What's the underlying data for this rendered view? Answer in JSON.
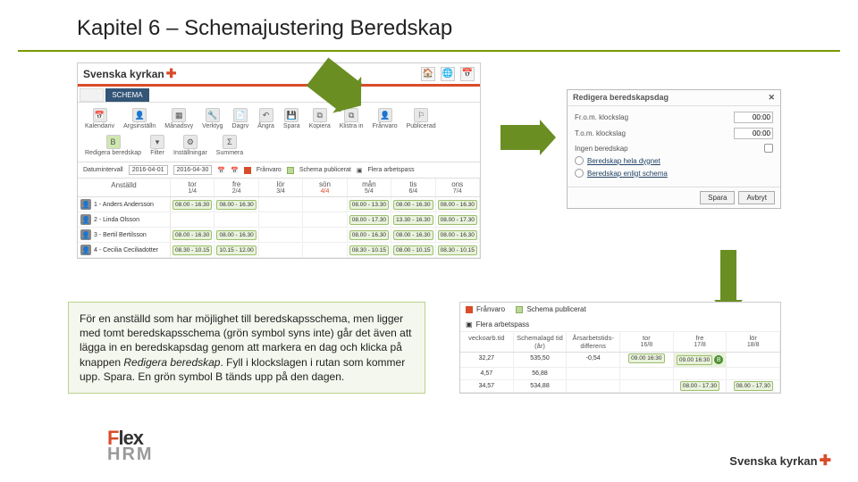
{
  "title": "Kapitel 6 – Schemajustering Beredskap",
  "brand": "Svenska kyrkan",
  "tabs": {
    "t0": "",
    "t1": "SCHEMA"
  },
  "toolbar": {
    "kalendariv": "Kalendariv",
    "argsinstv": "Argsinställn",
    "manadsvy": "Månadsvy",
    "verktyg": "Verktyg",
    "dagrv": "Dagrv",
    "angra": "Ångra",
    "spara": "Spara",
    "kopiera": "Kopiera",
    "klistrain": "Klistra in",
    "franvaro_btn": "Frånvaro",
    "publicerad": "Publicerad",
    "redigera_beredskap": "Redigera beredskap",
    "filter": "Filter",
    "installningar": "Inställningar",
    "summera": "Summera"
  },
  "filter": {
    "label": "Datumintervall",
    "from": "2016-04-01",
    "to": "2016-04-30",
    "franvaro": "Frånvaro",
    "schema_pub": "Schema publicerat",
    "flera": "Flera arbetspass"
  },
  "sched_header": {
    "emp": "Anställd",
    "d1": {
      "dow": "tor",
      "date": "1/4"
    },
    "d2": {
      "dow": "fre",
      "date": "2/4"
    },
    "d3": {
      "dow": "lör",
      "date": "3/4"
    },
    "d4": {
      "dow": "sön",
      "date": "4/4"
    },
    "d5": {
      "dow": "mån",
      "date": "5/4"
    },
    "d6": {
      "dow": "tis",
      "date": "6/4"
    },
    "d7": {
      "dow": "ons",
      "date": "7/4"
    }
  },
  "employees": [
    {
      "name": "1 - Anders Andersson",
      "cells": [
        "08.00 - 16.30",
        "08.00 - 16.30",
        "",
        "",
        "08.00 - 13.30",
        "08.00 - 16.30",
        "08.00 - 16.30"
      ]
    },
    {
      "name": "2 - Linda Olsson",
      "cells": [
        "",
        "",
        "",
        "",
        "08.00 - 17.30",
        "13.30 - 16.30",
        "08.00 - 17.30"
      ]
    },
    {
      "name": "3 - Bertil Bertilsson",
      "cells": [
        "08.00 - 16.30",
        "08.00 - 16.30",
        "",
        "",
        "08.00 - 16.30",
        "08.00 - 16.30",
        "08.00 - 16.30"
      ]
    },
    {
      "name": "4 - Cecilia Ceciliadotter",
      "cells": [
        "08.30 - 10.15",
        "10.15 - 12.00",
        "",
        "",
        "08.30 - 10.15",
        "08.00 - 10.15",
        "08.30 - 10.15"
      ]
    }
  ],
  "dialog": {
    "title": "Redigera beredskapsdag",
    "from_lbl": "Fr.o.m. klockslag",
    "to_lbl": "T.o.m. klockslag",
    "from_val": "00:00",
    "to_val": "00:00",
    "none": "Ingen beredskap",
    "whole": "Beredskap hela dygnet",
    "sched": "Beredskap enligt schema",
    "save": "Spara",
    "cancel": "Avbryt"
  },
  "note": "För en anställd som har möjlighet till beredskapsschema, men ligger med tomt beredskapsschema (grön symbol syns inte) går det även att lägga in en beredskapsdag genom att markera en dag och klicka på knappen <em>Redigera beredskap</em>. Fyll i klockslagen i rutan som kommer upp. Spara. En grön symbol B tänds upp på den dagen.",
  "mini": {
    "franvaro": "Frånvaro",
    "schema_pub": "Schema publicerat",
    "flera": "Flera arbetspass",
    "h1": "veckoarb.tid",
    "h2": "Schemalagd tid (år)",
    "h3": "Årsarbetstids-differens",
    "h4": {
      "dow": "tor",
      "date": "16/8"
    },
    "h5": {
      "dow": "fre",
      "date": "17/8"
    },
    "h6": {
      "dow": "lör",
      "date": "18/8"
    },
    "r1": {
      "c1": "32,27",
      "c2": "535,50",
      "c3": "-0,54",
      "c4": "09.00 16:30",
      "c5": "09.00 16:30",
      "c6": ""
    },
    "r2": {
      "c1": "4,57",
      "c2": "56,88",
      "c3": "",
      "c4": "",
      "c5": "",
      "c6": ""
    },
    "r3": {
      "c1": "34,57",
      "c2": "534,88",
      "c3": "",
      "c4": "",
      "c5": "08.00 - 17.30",
      "c6": "08.00 - 17.30"
    }
  },
  "flex": {
    "f": "Flex",
    "hrm": "HRM"
  },
  "footer_brand": "Svenska kyrkan"
}
